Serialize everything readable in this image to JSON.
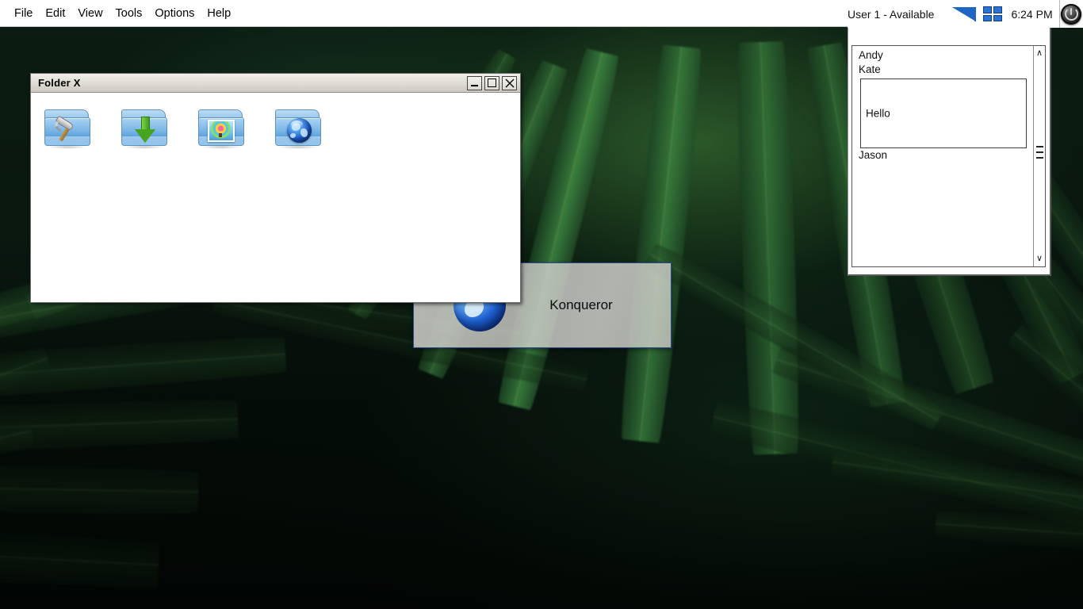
{
  "menubar": {
    "items": [
      {
        "label": "File",
        "name": "menu-file"
      },
      {
        "label": "Edit",
        "name": "menu-edit"
      },
      {
        "label": "View",
        "name": "menu-view"
      },
      {
        "label": "Tools",
        "name": "menu-tools"
      },
      {
        "label": "Options",
        "name": "menu-options"
      },
      {
        "label": "Help",
        "name": "menu-help"
      }
    ]
  },
  "tray": {
    "status": "User 1 - Available",
    "clock": "6:24 PM",
    "signal_icon": "signal-strength-icon",
    "grid_icon": "grid-squares-icon",
    "power_icon": "power-button-icon",
    "accent_blue": "#2a72d4"
  },
  "im_window": {
    "contacts": [
      {
        "name": "Andy"
      },
      {
        "name": "Kate"
      },
      {
        "name": "Jason"
      }
    ],
    "message": "Hello",
    "scroll_up_glyph": "∧",
    "scroll_down_glyph": "∨"
  },
  "folder_window": {
    "title": "Folder X",
    "buttons": {
      "minimize": "_",
      "maximize": "□",
      "close": "✕"
    },
    "icons": [
      {
        "name": "folder-development",
        "emblem": "hammer-icon"
      },
      {
        "name": "folder-downloads",
        "emblem": "down-arrow-icon"
      },
      {
        "name": "folder-pictures",
        "emblem": "photo-icon"
      },
      {
        "name": "folder-network",
        "emblem": "globe-icon"
      }
    ]
  },
  "konqueror": {
    "label": "Konqueror",
    "icon": "konqueror-globe-icon",
    "border_color": "#2a4a8c"
  },
  "wallpaper": {
    "description": "dark green leaf blades",
    "base_color": "#050a06",
    "highlight_color": "#4a8c3c"
  }
}
